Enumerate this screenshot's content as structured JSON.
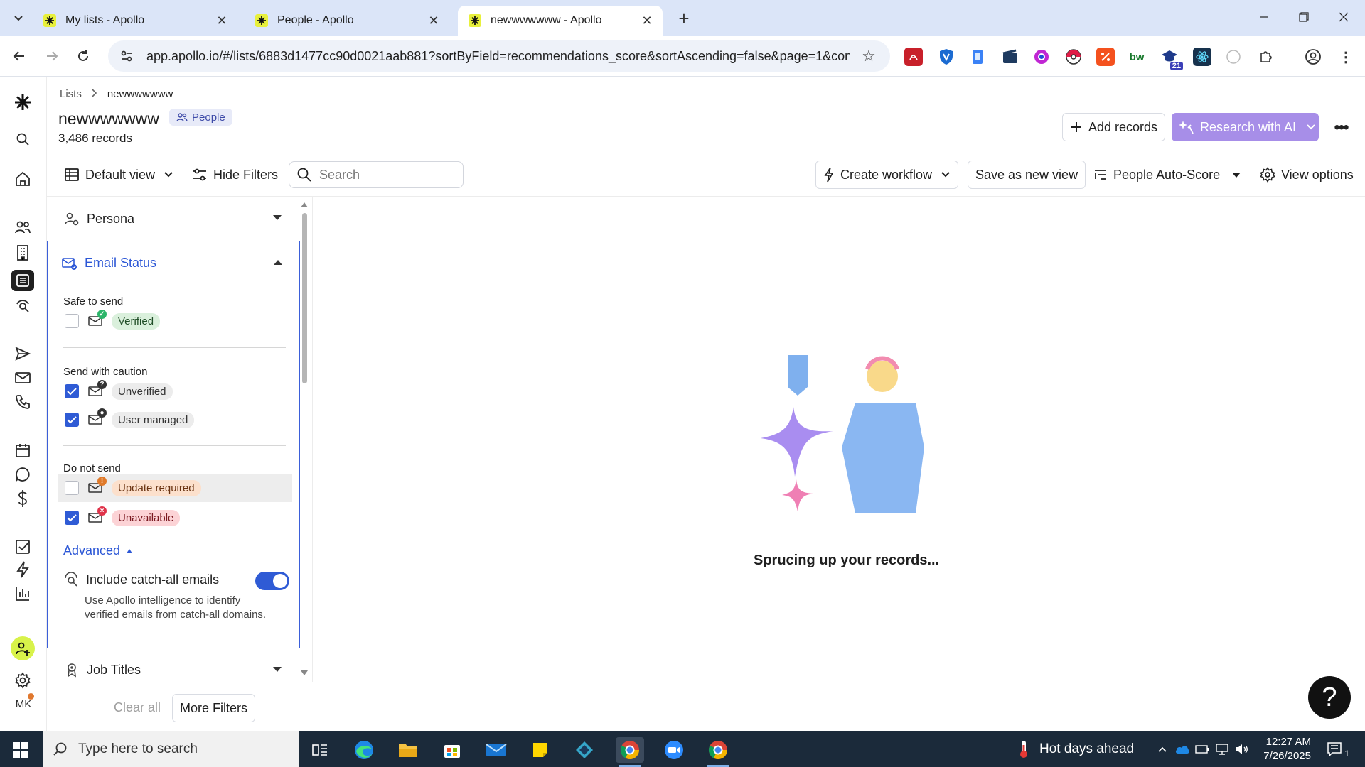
{
  "browser": {
    "tabs": [
      {
        "title": "My lists - Apollo",
        "active": false
      },
      {
        "title": "People - Apollo",
        "active": false
      },
      {
        "title": "newwwwwww - Apollo",
        "active": true
      }
    ],
    "url": "app.apollo.io/#/lists/6883d1477cc90d0021aab881?sortByField=recommendations_score&sortAscending=false&page=1&conta...",
    "extension_badge": "21"
  },
  "breadcrumb": {
    "root": "Lists",
    "current": "newwwwwww"
  },
  "header": {
    "title": "newwwwwww",
    "type_badge": "People",
    "records_count": "3,486 records",
    "add_records_label": "Add records",
    "research_ai_label": "Research with AI"
  },
  "toolbar": {
    "default_view_label": "Default view",
    "hide_filters_label": "Hide Filters",
    "search_placeholder": "Search",
    "create_workflow_label": "Create workflow",
    "save_view_label": "Save as new view",
    "auto_score_label": "People Auto-Score",
    "view_options_label": "View options"
  },
  "filters": {
    "persona_label": "Persona",
    "email_status_label": "Email Status",
    "groups": {
      "safe": {
        "label": "Safe to send",
        "options": [
          {
            "label": "Verified",
            "checked": false
          }
        ]
      },
      "caution": {
        "label": "Send with caution",
        "options": [
          {
            "label": "Unverified",
            "checked": true
          },
          {
            "label": "User managed",
            "checked": true
          }
        ]
      },
      "donot": {
        "label": "Do not send",
        "options": [
          {
            "label": "Update required",
            "checked": false
          },
          {
            "label": "Unavailable",
            "checked": true
          }
        ]
      }
    },
    "advanced_label": "Advanced",
    "catch_all_label": "Include catch-all emails",
    "catch_all_desc": "Use Apollo intelligence to identify verified emails from catch-all domains.",
    "catch_all_enabled": true,
    "job_titles_label": "Job Titles",
    "clear_all_label": "Clear all",
    "more_filters_label": "More Filters"
  },
  "main": {
    "loading_text": "Sprucing up your records..."
  },
  "rail": {
    "avatar_initials": "MK"
  },
  "taskbar": {
    "search_placeholder": "Type here to search",
    "weather": "Hot days ahead",
    "time": "12:27 AM",
    "date": "7/26/2025",
    "notification_count": "1"
  },
  "colors": {
    "accent": "#2c57d6",
    "ai_button": "#a78ee8",
    "rail_highlight": "#d8f24a",
    "taskbar": "#1b2a3a"
  }
}
